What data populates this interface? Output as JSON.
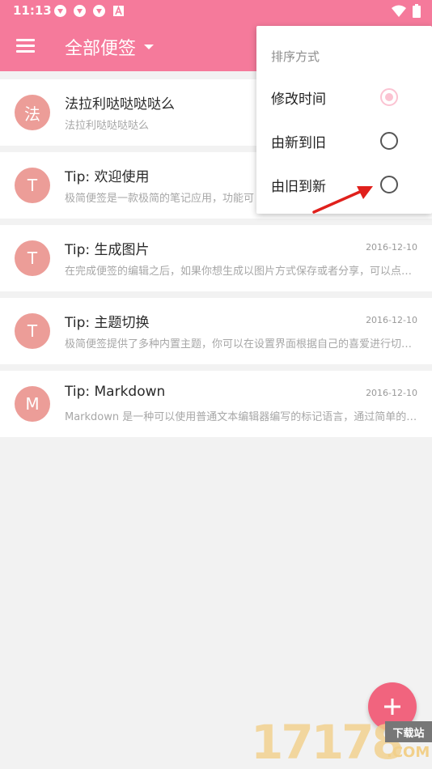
{
  "status_bar": {
    "time": "11:13",
    "notification_icons": [
      "app-icon",
      "app-icon",
      "app-icon",
      "a-icon"
    ],
    "right_icons": [
      "wifi-icon",
      "battery-icon"
    ]
  },
  "toolbar": {
    "title": "全部便签",
    "menu_icon": "hamburger-menu-icon",
    "dropdown_icon": "caret-down-icon",
    "color": "#f57a9b"
  },
  "notes": [
    {
      "avatar": "法",
      "title": "法拉利哒哒哒哒么",
      "preview": "法拉利哒哒哒哒么",
      "date": ""
    },
    {
      "avatar": "T",
      "title": "Tip: 欢迎使用",
      "preview": "极简便签是一款极简的笔记应用，功能可",
      "date": ""
    },
    {
      "avatar": "T",
      "title": "Tip: 生成图片",
      "preview": "在完成便签的编辑之后，如果你想生成以图片方式保存或者分享，可以点…",
      "date": "2016-12-10"
    },
    {
      "avatar": "T",
      "title": "Tip: 主题切换",
      "preview": "极简便签提供了多种内置主题，你可以在设置界面根据自己的喜爱进行切…",
      "date": "2016-12-10"
    },
    {
      "avatar": "M",
      "title": "Tip: Markdown",
      "preview": "Markdown 是一种可以使用普通文本编辑器编写的标记语言，通过简单的…",
      "date": "2016-12-10"
    }
  ],
  "sort_menu": {
    "header": "排序方式",
    "options": [
      {
        "label": "修改时间",
        "selected": true
      },
      {
        "label": "由新到旧",
        "selected": false
      },
      {
        "label": "由旧到新",
        "selected": false
      }
    ]
  },
  "fab_icon": "add-icon",
  "watermark": {
    "digits": "17178",
    "site": "下载站",
    "domain": ".COM"
  },
  "colors": {
    "accent": "#f57a9b",
    "avatar": "#ec9d98",
    "fab": "#f1647e",
    "radio_selected": "#fbc3d2",
    "arrow": "#e0201c"
  }
}
